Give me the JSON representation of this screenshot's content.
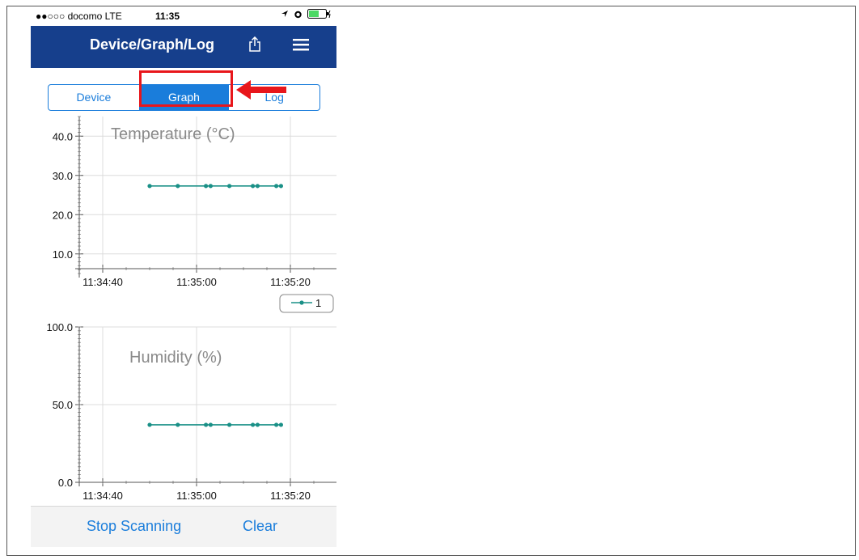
{
  "status_bar": {
    "carrier": "●●○○○ docomo  LTE",
    "time": "11:35"
  },
  "nav": {
    "title": "Device/Graph/Log",
    "share_icon": "share-icon",
    "menu_icon": "hamburger-menu-icon",
    "bar_color": "#163f8c"
  },
  "tabs": [
    {
      "label": "Device",
      "active": false
    },
    {
      "label": "Graph",
      "active": true
    },
    {
      "label": "Log",
      "active": false
    }
  ],
  "accent_color": "#1a7ddb",
  "annotation_color": "#e8161b",
  "chart_data": [
    {
      "type": "line",
      "title": "Temperature (°C)",
      "x_ticks": [
        "11:34:40",
        "11:35:00",
        "11:35:20"
      ],
      "y_ticks": [
        "10.0",
        "20.0",
        "30.0",
        "40.0"
      ],
      "ylim": [
        5,
        45
      ],
      "grid": true,
      "legend": "bottom-right",
      "series": [
        {
          "name": "1",
          "color": "#1a9087",
          "x": [
            "11:34:50",
            "11:34:56",
            "11:35:02",
            "11:35:03",
            "11:35:07",
            "11:35:12",
            "11:35:13",
            "11:35:17",
            "11:35:18"
          ],
          "values": [
            27.3,
            27.3,
            27.3,
            27.3,
            27.3,
            27.3,
            27.3,
            27.3,
            27.3
          ]
        }
      ]
    },
    {
      "type": "line",
      "title": "Humidity (%)",
      "x_ticks": [
        "11:34:40",
        "11:35:00",
        "11:35:20"
      ],
      "y_ticks": [
        "0.0",
        "50.0",
        "100.0"
      ],
      "ylim": [
        0,
        100
      ],
      "grid": true,
      "series": [
        {
          "name": "1",
          "color": "#1a9087",
          "x": [
            "11:34:50",
            "11:34:56",
            "11:35:02",
            "11:35:03",
            "11:35:07",
            "11:35:12",
            "11:35:13",
            "11:35:17",
            "11:35:18"
          ],
          "values": [
            37,
            37,
            37,
            37,
            37,
            37,
            37,
            37,
            37
          ]
        }
      ]
    }
  ],
  "bottom": {
    "stop_label": "Stop Scanning",
    "clear_label": "Clear"
  }
}
